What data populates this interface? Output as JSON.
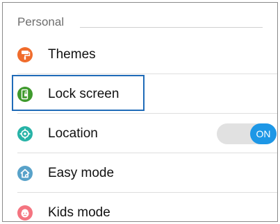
{
  "section": {
    "title": "Personal"
  },
  "items": [
    {
      "label": "Themes",
      "icon": "paint-roller-icon",
      "color": "#f06c2c"
    },
    {
      "label": "Lock screen",
      "icon": "lock-screen-icon",
      "color": "#3f9a2d",
      "focused": true
    },
    {
      "label": "Location",
      "icon": "location-crosshair-icon",
      "color": "#27b3a7",
      "toggle": {
        "state_label": "ON",
        "on": true,
        "color": "#1d97e6"
      }
    },
    {
      "label": "Easy mode",
      "icon": "home-icon",
      "color": "#58a2c9"
    },
    {
      "label": "Kids mode",
      "icon": "kids-face-icon",
      "color": "#f47480"
    }
  ]
}
